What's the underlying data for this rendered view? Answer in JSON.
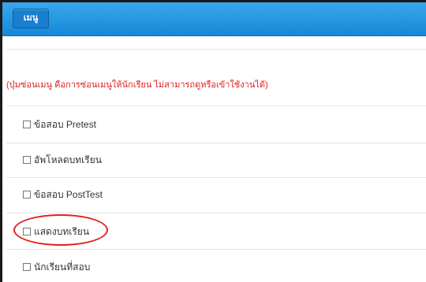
{
  "header": {
    "menu_button_label": "เมนู"
  },
  "note": "(ปุ่มซ่อนเมนู คือการซ่อนเมนูให้นักเรียน ไม่สามารถดูหรือเข้าใช้งานได้)",
  "menu_items": [
    {
      "label": "ข้อสอบ Pretest",
      "checked": false
    },
    {
      "label": "อัพโหลดบทเรียน",
      "checked": false
    },
    {
      "label": "ข้อสอบ PostTest",
      "checked": false
    },
    {
      "label": "แสดงบทเรียน",
      "checked": false,
      "highlighted": true
    },
    {
      "label": "นักเรียนที่สอบ",
      "checked": false
    }
  ],
  "colors": {
    "header_bar": "#1a8ee0",
    "note_text": "#e02020",
    "highlight_circle": "#e02020"
  }
}
